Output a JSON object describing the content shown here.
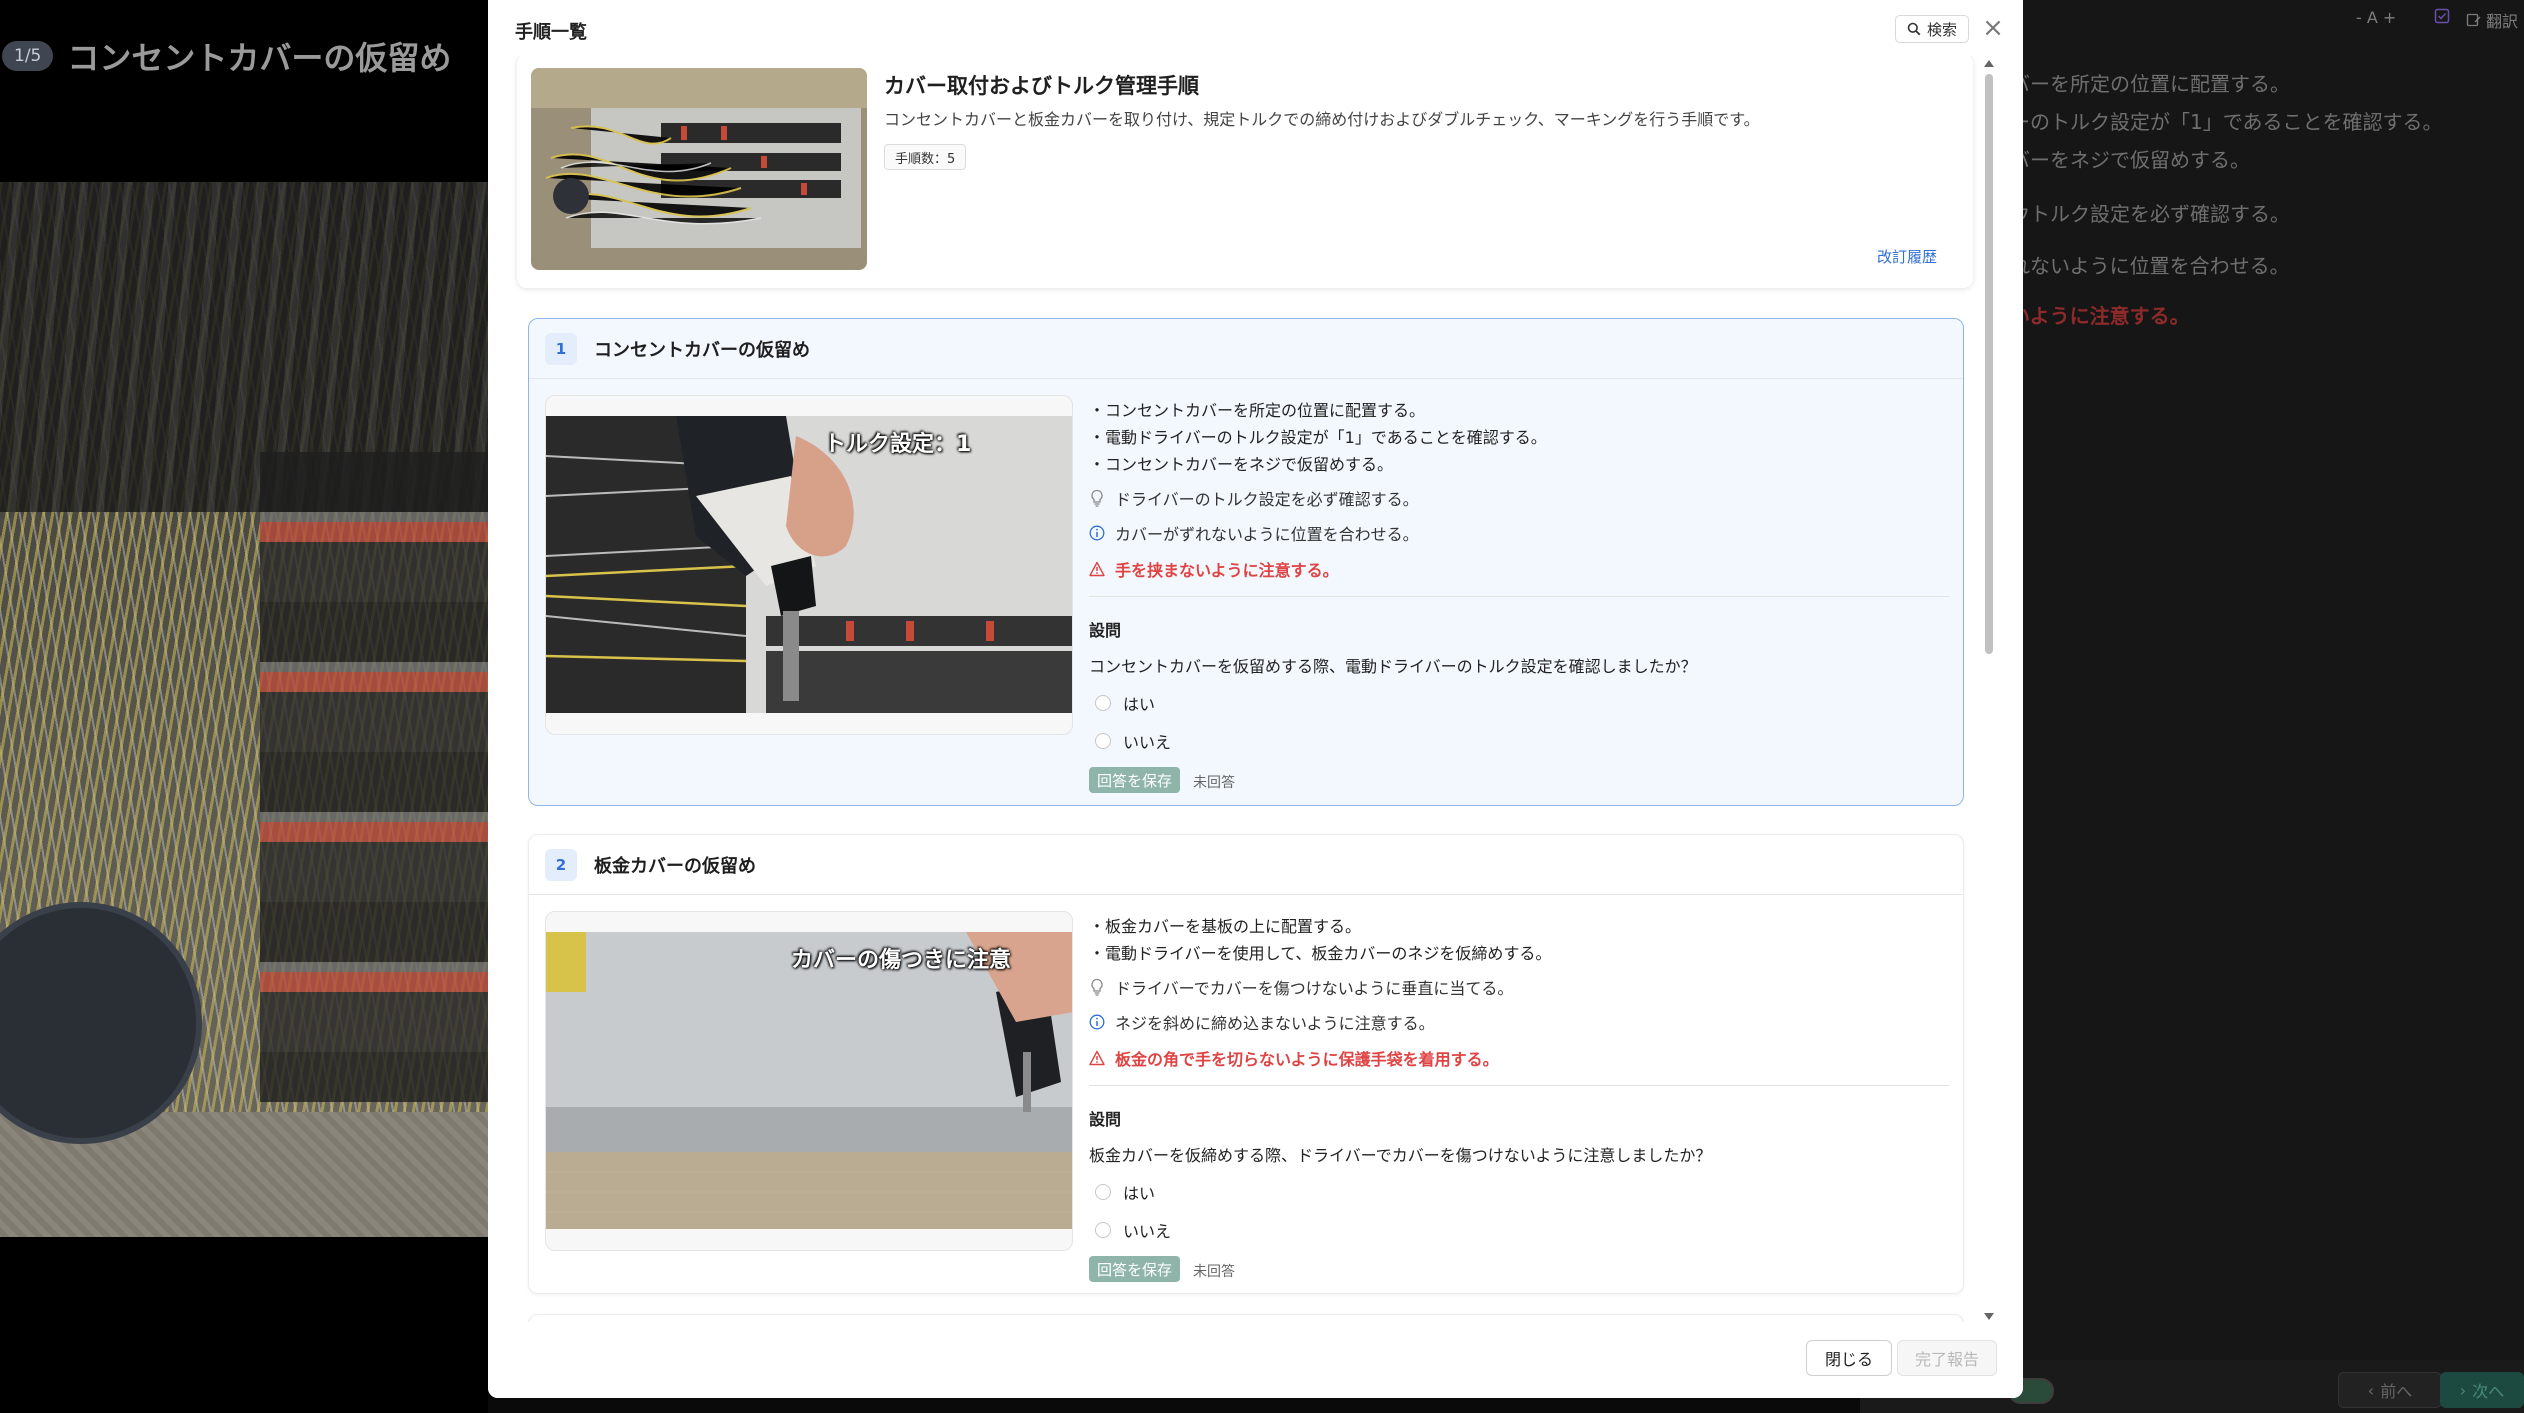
{
  "background": {
    "step_counter": "1/5",
    "step_title": "コンセントカバーの仮留め",
    "toolbar": {
      "font_minus": "- A +",
      "translate": "翻訳"
    },
    "visible_lines": [
      "バーを所定の位置に配置する。",
      "ーのトルク設定が「1」であることを確認する。",
      "バーをネジで仮留めする。",
      "ウトルク設定を必ず確認する。",
      "れないように位置を合わせる。",
      "いように注意する。"
    ],
    "prev_label": "前へ",
    "next_label": "次へ"
  },
  "modal": {
    "title": "手順一覧",
    "search_label": "検索",
    "close_icon": "×",
    "overview": {
      "title": "カバー取付およびトルク管理手順",
      "description": "コンセントカバーと板金カバーを取り付け、規定トルクでの締め付けおよびダブルチェック、マーキングを行う手順です。",
      "step_count": "手順数：5",
      "revision_link": "改訂履歴"
    },
    "steps": [
      {
        "number": "1",
        "title": "コンセントカバーの仮留め",
        "image_caption": "トルク設定：1",
        "bullets": [
          "・コンセントカバーを所定の位置に配置する。",
          "・電動ドライバーのトルク設定が「1」であることを確認する。",
          "・コンセントカバーをネジで仮留めする。"
        ],
        "tip": "ドライバーのトルク設定を必ず確認する。",
        "info": "カバーがずれないように位置を合わせる。",
        "warning": "手を挟まないように注意する。",
        "question_label": "設問",
        "question": "コンセントカバーを仮留めする際、電動ドライバーのトルク設定を確認しましたか？",
        "options": [
          "はい",
          "いいえ"
        ],
        "save_label": "回答を保存",
        "status": "未回答"
      },
      {
        "number": "2",
        "title": "板金カバーの仮留め",
        "image_caption": "カバーの傷つきに注意",
        "bullets": [
          "・板金カバーを基板の上に配置する。",
          "・電動ドライバーを使用して、板金カバーのネジを仮締めする。"
        ],
        "tip": "ドライバーでカバーを傷つけないように垂直に当てる。",
        "info": "ネジを斜めに締め込まないように注意する。",
        "warning": "板金の角で手を切らないように保護手袋を着用する。",
        "question_label": "設問",
        "question": "板金カバーを仮締めする際、ドライバーでカバーを傷つけないように注意しましたか？",
        "options": [
          "はい",
          "いいえ"
        ],
        "save_label": "回答を保存",
        "status": "未回答"
      }
    ],
    "footer": {
      "close_label": "閉じる",
      "done_label": "完了報告"
    }
  },
  "colors": {
    "accent": "#2f6fd6",
    "warning": "#e04343",
    "save_button": "#8fb5ab",
    "active_border": "#8fb5e8"
  }
}
